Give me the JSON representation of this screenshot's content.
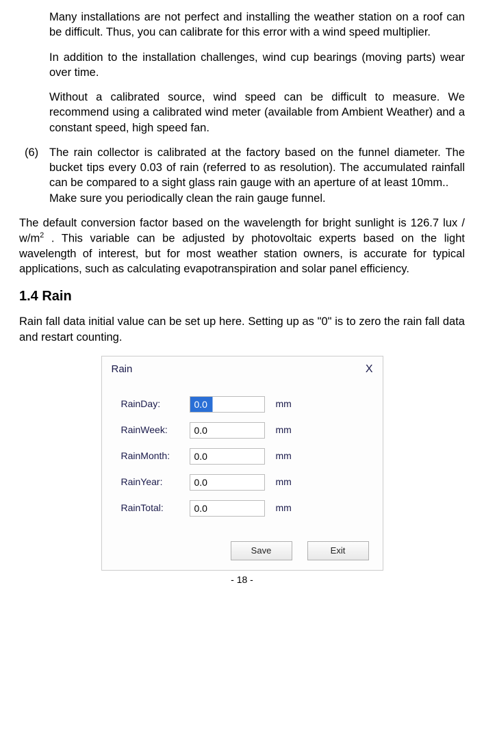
{
  "paragraphs": {
    "p1": "Many installations are not perfect and installing the weather station on a roof can be difficult. Thus, you can calibrate for this error with a wind speed multiplier.",
    "p2": "In addition to the installation challenges, wind cup bearings (moving parts) wear over time.",
    "p3": "Without a calibrated source, wind speed can be difficult to measure. We recommend using a calibrated wind meter (available from Ambient Weather) and a constant speed, high speed fan.",
    "item6_num": "(6)",
    "item6_a": "The rain collector is calibrated at the factory based on the funnel diameter. The bucket tips every 0.03 of rain (referred to as resolution). The accumulated rainfall can be compared to a sight glass rain gauge with an aperture of at least 10mm..",
    "item6_b": "Make sure you periodically clean the rain gauge funnel.",
    "conv_a": "The default conversion factor based on the wavelength for bright sunlight is 126.7 lux / w/m",
    "conv_sup": "2",
    "conv_b": " . This variable can be adjusted by photovoltaic experts based on the light wavelength of interest, but for most weather station owners, is accurate for typical applications, such as calculating evapotranspiration and solar panel efficiency.",
    "heading": "1.4 Rain",
    "rain_intro": "Rain fall data initial value can be set up here. Setting up as \"0\" is to zero the rain fall data and restart counting."
  },
  "dialog": {
    "title": "Rain",
    "close": "X",
    "rows": [
      {
        "label": "RainDay:",
        "value": "0.0",
        "unit": "mm",
        "selected": true
      },
      {
        "label": "RainWeek:",
        "value": "0.0",
        "unit": "mm",
        "selected": false
      },
      {
        "label": "RainMonth:",
        "value": "0.0",
        "unit": "mm",
        "selected": false
      },
      {
        "label": "RainYear:",
        "value": "0.0",
        "unit": "mm",
        "selected": false
      },
      {
        "label": "RainTotal:",
        "value": "0.0",
        "unit": "mm",
        "selected": false
      }
    ],
    "buttons": {
      "save": "Save",
      "exit": "Exit"
    }
  },
  "page_number": "- 18 -"
}
